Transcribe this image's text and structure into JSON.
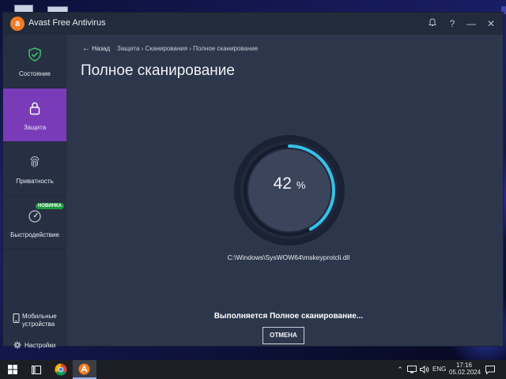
{
  "window": {
    "title": "Avast Free Antivirus"
  },
  "titlebar": {
    "bell_icon": "bell-icon",
    "help_label": "?",
    "minimize_label": "—",
    "close_label": "✕"
  },
  "sidebar": {
    "items": [
      {
        "label": "Состояние",
        "icon": "shield-check-icon"
      },
      {
        "label": "Защита",
        "icon": "lock-icon",
        "active": true
      },
      {
        "label": "Приватность",
        "icon": "fingerprint-icon"
      },
      {
        "label": "Быстродействие",
        "icon": "speedometer-icon",
        "badge": "НОВИНКА"
      }
    ],
    "mobile_label_1": "Мобильные",
    "mobile_label_2": "устройства",
    "settings_label": "Настройки"
  },
  "breadcrumb": {
    "back": "Назад",
    "path1": "Защита",
    "path2": "Сканирования",
    "path3": "Полное сканирование",
    "sep": "›"
  },
  "main": {
    "title": "Полное сканирование",
    "progress_value": "42",
    "progress_unit": "%",
    "progress_fraction": 0.42,
    "current_file": "C:\\Windows\\SysWOW64\\mskeyprotcli.dll",
    "status": "Выполняется Полное сканирование...",
    "cancel_label": "ОТМЕНА"
  },
  "taskbar": {
    "language": "ENG",
    "time": "17:16",
    "date": "05.02.2024"
  },
  "colors": {
    "accent_purple": "#7a3bb9",
    "progress_cyan": "#37c0e8",
    "avast_orange": "#f47c20",
    "badge_green": "#1a9b3a"
  }
}
